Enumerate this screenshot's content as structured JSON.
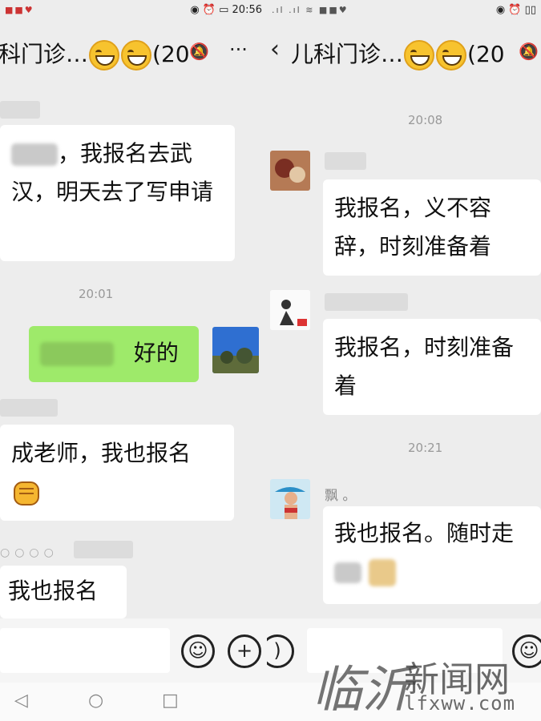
{
  "left": {
    "status_time": "20:56",
    "title": "科门诊…",
    "title_suffix": "(20",
    "more": "···",
    "time1": "20:01",
    "messages": [
      {
        "text": "，我报名去武汉，明天去了写申请"
      },
      {
        "text": "好的"
      },
      {
        "text": "成老师，我也报名"
      },
      {
        "text": "我也报名"
      }
    ]
  },
  "right": {
    "back": "‹",
    "title": "儿科门诊…",
    "title_suffix": "(20",
    "time1": "20:08",
    "time2": "20:21",
    "sender3": "飘 。",
    "messages": [
      {
        "text": "我报名，义不容辞，时刻准备着"
      },
      {
        "text": "我报名，时刻准备着"
      },
      {
        "text": "我也报名。随时走"
      }
    ]
  },
  "watermark": {
    "brand": "临沂",
    "site": "新闻网",
    "url": "lfxww.com"
  },
  "icons": [
    "bell-off-icon",
    "more-icon",
    "back-icon",
    "emoji-icon",
    "add-icon",
    "voice-icon",
    "nav-back-icon",
    "nav-home-icon",
    "nav-recent-icon",
    "fist-emoji-icon"
  ]
}
